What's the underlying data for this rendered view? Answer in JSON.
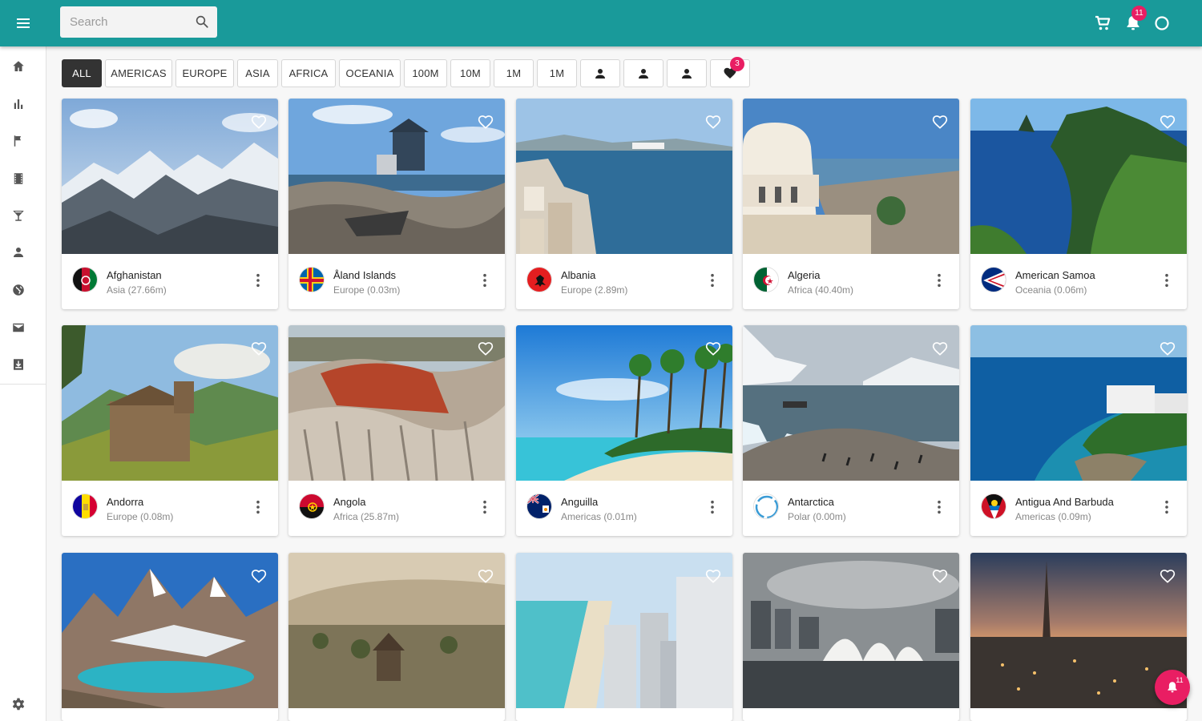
{
  "header": {
    "search_placeholder": "Search",
    "notifications_badge": "11",
    "colors": {
      "bar": "#199a9a",
      "badge": "#e91e63"
    }
  },
  "sidebar": {
    "items": [
      {
        "icon": "home-icon"
      },
      {
        "icon": "bar-chart-icon"
      },
      {
        "icon": "flag-icon"
      },
      {
        "icon": "film-icon"
      },
      {
        "icon": "cocktail-icon"
      },
      {
        "icon": "person-icon"
      },
      {
        "icon": "globe-icon"
      },
      {
        "icon": "mail-icon"
      },
      {
        "icon": "download-box-icon"
      }
    ],
    "footer_icon": "settings-icon"
  },
  "filters": {
    "labels": [
      "ALL",
      "AMERICAS",
      "EUROPE",
      "ASIA",
      "AFRICA",
      "OCEANIA",
      "100M",
      "10M",
      "1M",
      "1M"
    ],
    "active": "ALL",
    "person_filters": 3,
    "favorites_badge": "3"
  },
  "cards": [
    {
      "name": "Afghanistan",
      "sub": "Asia (27.66m)"
    },
    {
      "name": "Åland Islands",
      "sub": "Europe (0.03m)"
    },
    {
      "name": "Albania",
      "sub": "Europe (2.89m)"
    },
    {
      "name": "Algeria",
      "sub": "Africa (40.40m)"
    },
    {
      "name": "American Samoa",
      "sub": "Oceania (0.06m)"
    },
    {
      "name": "Andorra",
      "sub": "Europe (0.08m)"
    },
    {
      "name": "Angola",
      "sub": "Africa (25.87m)"
    },
    {
      "name": "Anguilla",
      "sub": "Americas (0.01m)"
    },
    {
      "name": "Antarctica",
      "sub": "Polar (0.00m)"
    },
    {
      "name": "Antigua And Barbuda",
      "sub": "Americas (0.09m)"
    }
  ],
  "fab": {
    "badge": "11"
  }
}
